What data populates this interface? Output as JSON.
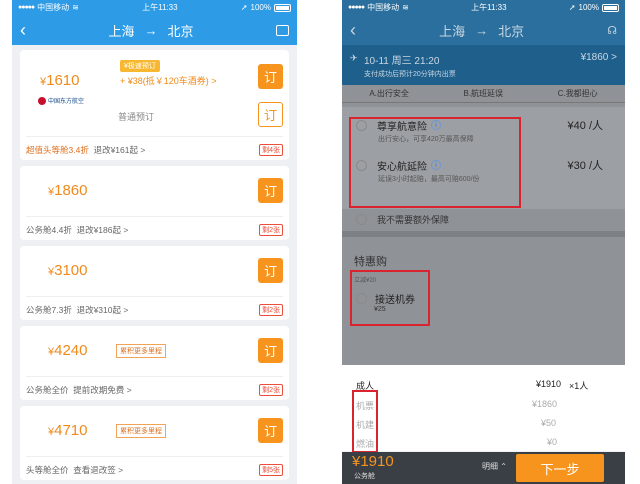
{
  "status": {
    "carrier": "中国移动",
    "time": "上午11:33",
    "battery": "100%"
  },
  "route": {
    "from": "上海",
    "arrow": "→",
    "to": "北京"
  },
  "left": {
    "cards": [
      {
        "price": "1610",
        "promo": "+ ¥38(抵￥120车酒券) >",
        "promo_tag": "¥极速预订",
        "airline": "中国东方航空",
        "note": "普通预订",
        "book": "订",
        "cabin": "超值头等舱3.4折",
        "refund": "退改¥161起 >",
        "left": "剩4张"
      },
      {
        "price": "1860",
        "book": "订",
        "cabin": "公务舱4.4折",
        "refund": "退改¥186起 >",
        "left": "剩2张"
      },
      {
        "price": "3100",
        "book": "订",
        "cabin": "公务舱7.3折",
        "refund": "退改¥310起 >",
        "left": "剩2张"
      },
      {
        "price": "4240",
        "badge": "累积更多里程",
        "book": "订",
        "cabin": "公务舱全价",
        "refund": "提前改期免费 >",
        "left": "剩2张"
      },
      {
        "price": "4710",
        "badge": "累积更多里程",
        "book": "订",
        "cabin": "头等舱全价",
        "refund": "查看退改签 >",
        "left": "剩5张"
      }
    ]
  },
  "right": {
    "flight": {
      "date": "10-11 周三 21:20",
      "price": "¥1860 >",
      "sub": "支付成功后预计20分钟内出票"
    },
    "tabs": [
      "A.出行安全",
      "B.航班延误",
      "C.我都担心"
    ],
    "insurance": [
      {
        "name": "尊享航意险",
        "desc": "出行安心，可享420万最高保障",
        "price": "¥40 /人"
      },
      {
        "name": "安心航延险",
        "desc": "延误3小时起赔，最高可赔600/份",
        "price": "¥30 /人"
      }
    ],
    "no_ins": "我不需要额外保障",
    "special_title": "特惠购",
    "special_tag": "立减¥20",
    "transfer": {
      "name": "接送机券",
      "price": "¥25"
    },
    "detail": {
      "label": "成人",
      "total": "¥1910",
      "count": "×1人",
      "rows": [
        {
          "k": "机票",
          "v": "¥1860"
        },
        {
          "k": "机建",
          "v": "¥50"
        },
        {
          "k": "燃油",
          "v": "¥0"
        }
      ]
    },
    "footer": {
      "price": "¥1910",
      "cabin": "公务舱",
      "detail": "明细",
      "next": "下一步"
    }
  }
}
